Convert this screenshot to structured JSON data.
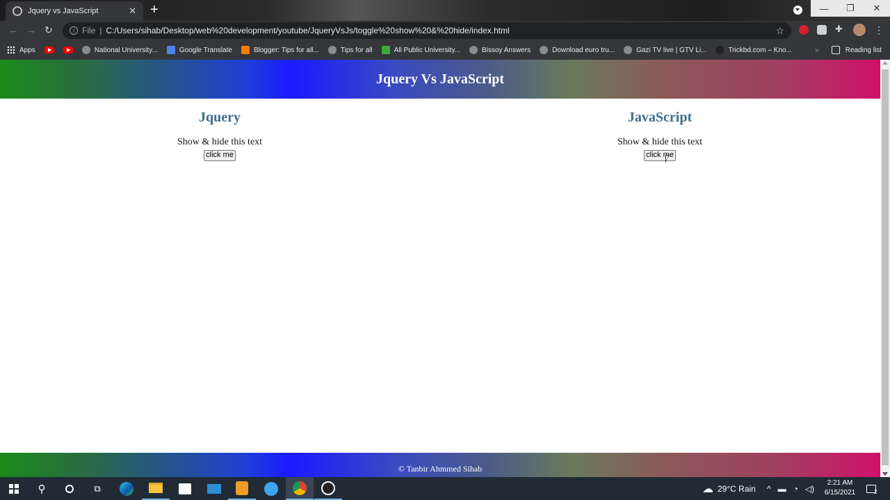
{
  "browser": {
    "tab_title": "Jquery vs JavaScript",
    "tab_close": "✕",
    "new_tab": "+",
    "address": {
      "scheme_label": "File",
      "separator": "|",
      "url": "C:/Users/sihab/Desktop/web%20development/youtube/JqueryVsJs/toggle%20show%20&%20hide/index.html"
    },
    "bookmarks": [
      {
        "label": "Apps",
        "icon": "apps-grid-icon"
      },
      {
        "label": "",
        "icon": "youtube-icon"
      },
      {
        "label": "",
        "icon": "youtube-icon"
      },
      {
        "label": "National University...",
        "icon": "globe-icon"
      },
      {
        "label": "Google Translate",
        "icon": "translate-icon"
      },
      {
        "label": "Blogger: Tips for all...",
        "icon": "blogger-icon"
      },
      {
        "label": "Tips for all",
        "icon": "globe-icon"
      },
      {
        "label": "All Public University...",
        "icon": "check-icon"
      },
      {
        "label": "Bissoy Answers",
        "icon": "globe-icon"
      },
      {
        "label": "Download euro tru...",
        "icon": "globe-icon"
      },
      {
        "label": "Gazi TV live | GTV Li...",
        "icon": "globe-icon"
      },
      {
        "label": "Trickbd.com – Kno...",
        "icon": "globe-icon"
      }
    ],
    "bookmarks_more": "»",
    "reading_list": "Reading list",
    "colors": {
      "frame": "#35363a",
      "omnibox": "#202124"
    }
  },
  "page": {
    "header_title": "Jquery Vs JavaScript",
    "columns": [
      {
        "heading": "Jquery",
        "text": "Show & hide this text",
        "button": "click me"
      },
      {
        "heading": "JavaScript",
        "text": "Show & hide this text",
        "button": "click me"
      }
    ],
    "footer": "© Tanbir Ahmmed Sihab",
    "colors": {
      "heading": "#3f6e8a",
      "gradient_start": "#1b8a1b",
      "gradient_mid": "#1a1aff",
      "gradient_end": "#d0106a"
    }
  },
  "taskbar": {
    "weather": "29°C  Rain",
    "time": "2:21 AM",
    "date": "6/15/2021",
    "notification_count": "2"
  }
}
